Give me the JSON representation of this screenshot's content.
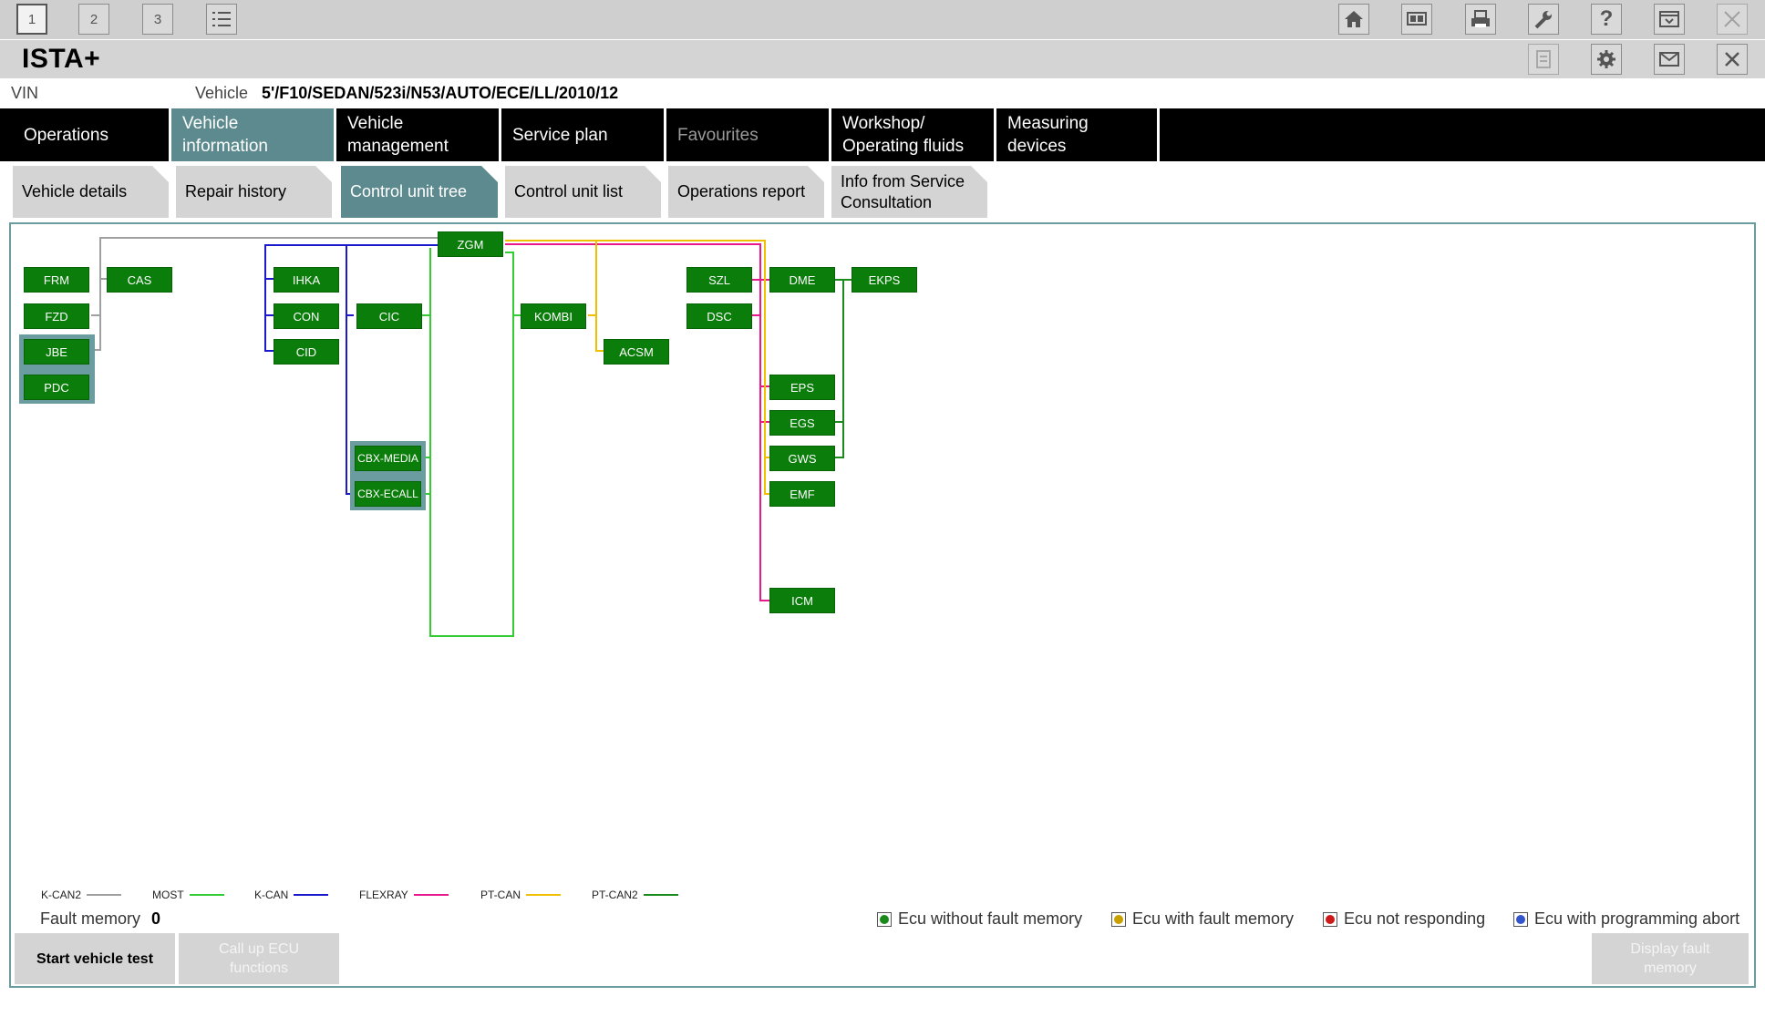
{
  "toolbar": {
    "session_buttons": [
      "1",
      "2",
      "3"
    ],
    "icons": [
      "list-icon",
      "home-icon",
      "display-icon",
      "print-icon",
      "wrench-icon",
      "help-icon",
      "minimize-icon",
      "close-icon"
    ]
  },
  "titlebar": {
    "title": "ISTA+",
    "icons": [
      "notes-icon",
      "gear-icon",
      "mail-icon",
      "close-icon"
    ]
  },
  "vehicle": {
    "vin_label": "VIN",
    "vehicle_label": "Vehicle",
    "vehicle_value": "5'/F10/SEDAN/523i/N53/AUTO/ECE/LL/2010/12"
  },
  "main_tabs": [
    {
      "label": "Operations",
      "state": "normal"
    },
    {
      "label": "Vehicle information",
      "state": "active"
    },
    {
      "label": "Vehicle\nmanagement",
      "state": "normal"
    },
    {
      "label": "Service plan",
      "state": "normal"
    },
    {
      "label": "Favourites",
      "state": "disabled"
    },
    {
      "label": "Workshop/\nOperating fluids",
      "state": "normal"
    },
    {
      "label": "Measuring devices",
      "state": "normal"
    }
  ],
  "sub_tabs": [
    {
      "label": "Vehicle details",
      "state": "normal"
    },
    {
      "label": "Repair history",
      "state": "normal"
    },
    {
      "label": "Control unit tree",
      "state": "active"
    },
    {
      "label": "Control unit list",
      "state": "normal"
    },
    {
      "label": "Operations report",
      "state": "normal"
    },
    {
      "label": "Info from Service\nConsultation",
      "state": "normal"
    }
  ],
  "ecus": [
    "ZGM",
    "FRM",
    "CAS",
    "FZD",
    "JBE",
    "PDC",
    "IHKA",
    "CON",
    "CIC",
    "CID",
    "CBX-MEDIA",
    "CBX-ECALL",
    "KOMBI",
    "ACSM",
    "SZL",
    "DSC",
    "DME",
    "EKPS",
    "EPS",
    "EGS",
    "GWS",
    "EMF",
    "ICM"
  ],
  "legend": [
    {
      "label": "K-CAN2",
      "color": "#a0a0a0"
    },
    {
      "label": "MOST",
      "color": "#33cc33"
    },
    {
      "label": "K-CAN",
      "color": "#1a1acc"
    },
    {
      "label": "FLEXRAY",
      "color": "#e8198c"
    },
    {
      "label": "PT-CAN",
      "color": "#f0c000"
    },
    {
      "label": "PT-CAN2",
      "color": "#1a8a1a"
    }
  ],
  "fault_memory": {
    "label": "Fault memory",
    "value": "0"
  },
  "status_legend": [
    {
      "label": "Ecu without fault memory",
      "color": "#1a8a1a"
    },
    {
      "label": "Ecu with fault memory",
      "color": "#c8a000"
    },
    {
      "label": "Ecu not responding",
      "color": "#cc1a1a"
    },
    {
      "label": "Ecu with programming abort",
      "color": "#3355cc"
    }
  ],
  "buttons": {
    "start_vehicle_test": "Start vehicle test",
    "call_up_ecu_functions": "Call up ECU functions",
    "display_fault_memory": "Display fault memory"
  }
}
